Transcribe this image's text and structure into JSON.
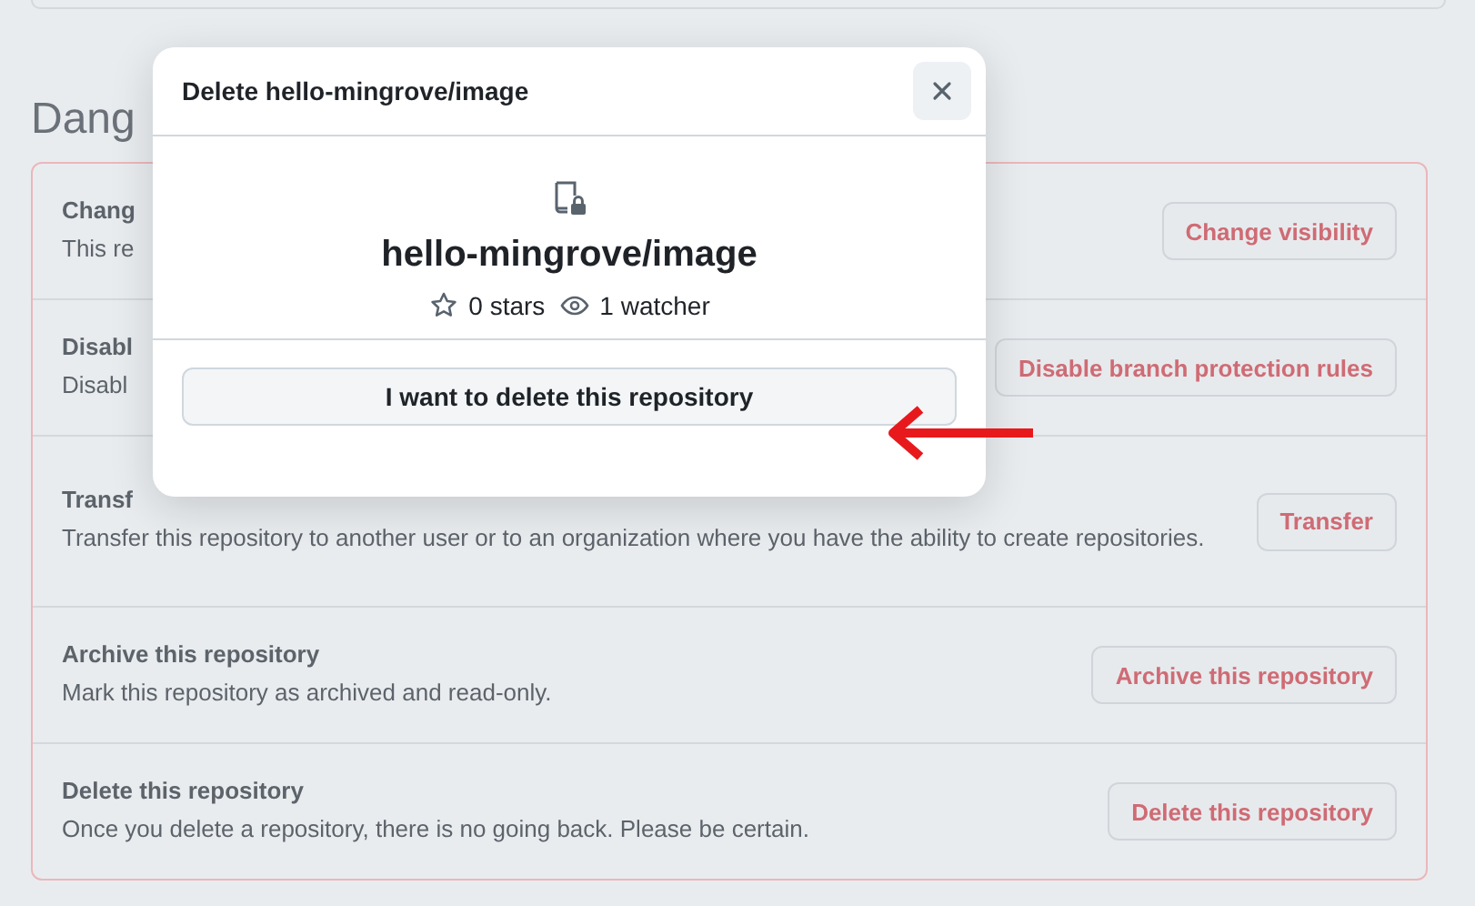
{
  "heading": "Dang",
  "danger_rows": [
    {
      "title": "Chang",
      "description": "This re",
      "button": "Change visibility"
    },
    {
      "title": "Disabl",
      "description": "Disabl",
      "button": "Disable branch protection rules"
    },
    {
      "title": "Transf",
      "description": "Transfer this repository to another user or to an organization where you have the ability to create repositories.",
      "button": "Transfer"
    },
    {
      "title": "Archive this repository",
      "description": "Mark this repository as archived and read-only.",
      "button": "Archive this repository"
    },
    {
      "title": "Delete this repository",
      "description": "Once you delete a repository, there is no going back. Please be certain.",
      "button": "Delete this repository"
    }
  ],
  "dialog": {
    "title": "Delete hello-mingrove/image",
    "repo_name": "hello-mingrove/image",
    "stars": "0 stars",
    "watchers": "1 watcher",
    "confirm_button": "I want to delete this repository"
  }
}
